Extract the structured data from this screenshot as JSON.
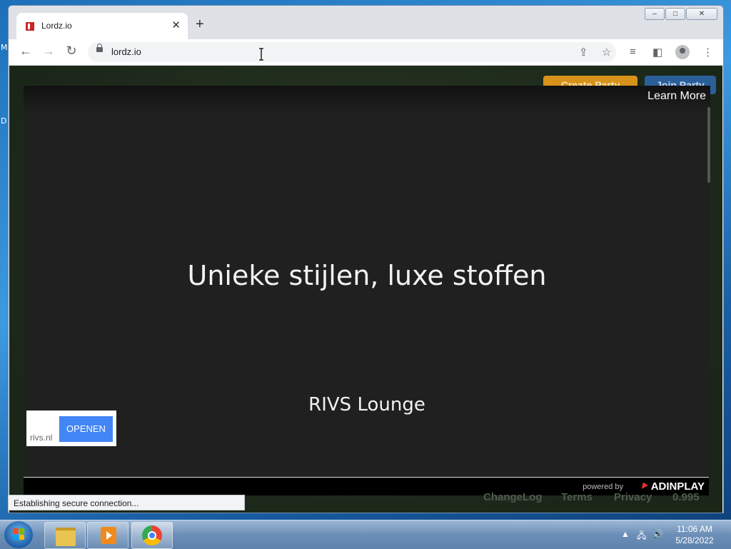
{
  "desktop": {
    "letters": [
      "M",
      "D"
    ]
  },
  "browser": {
    "tab": {
      "title": "Lordz.io",
      "close": "✕"
    },
    "new_tab": "+",
    "toolbar": {
      "url": "lordz.io",
      "back": "←",
      "forward": "→",
      "reload": "↻"
    },
    "caption": {
      "minimize": "–",
      "maximize": "□",
      "close": "✕"
    }
  },
  "page": {
    "create_party": "Create Party",
    "join_party": "Join Party",
    "footer": {
      "changelog": "ChangeLog",
      "terms": "Terms",
      "privacy": "Privacy",
      "version": "0.995"
    }
  },
  "ad": {
    "learn_more": "Learn More",
    "headline": "Unieke stijlen, luxe stoffen",
    "brand": "RIVS Lounge",
    "domain": "rivs.nl",
    "cta": "OPENEN",
    "powered_by": "powered by",
    "network": "ADINPLAY"
  },
  "status_bar": {
    "text": "Establishing secure connection..."
  },
  "taskbar": {
    "items": [
      "file-explorer",
      "media-player",
      "chrome"
    ],
    "clock": {
      "time": "11:06 AM",
      "date": "5/28/2022"
    }
  }
}
